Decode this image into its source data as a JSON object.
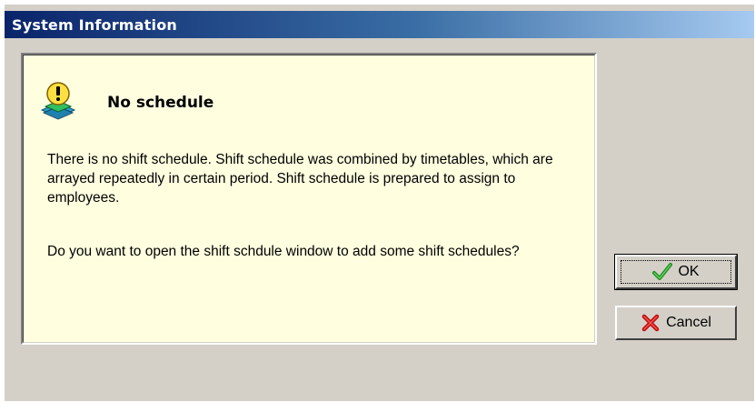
{
  "window": {
    "title": "System Information"
  },
  "message": {
    "heading": "No schedule",
    "paragraph1": "There is no shift schedule. Shift schedule was combined by timetables, which are arrayed repeatedly in certain period. Shift schedule is prepared to assign to employees.",
    "paragraph2": "Do you want to open the shift schdule window to add some shift schedules?",
    "icon": "warning-exclamation-icon"
  },
  "buttons": {
    "ok_label": "OK",
    "cancel_label": "Cancel",
    "ok_icon": "checkmark-icon",
    "cancel_icon": "x-cross-icon"
  },
  "colors": {
    "title_gradient_start": "#0a246a",
    "title_gradient_end": "#a6caf0",
    "panel_background": "#ffffe0",
    "window_background": "#d4d0c8"
  }
}
